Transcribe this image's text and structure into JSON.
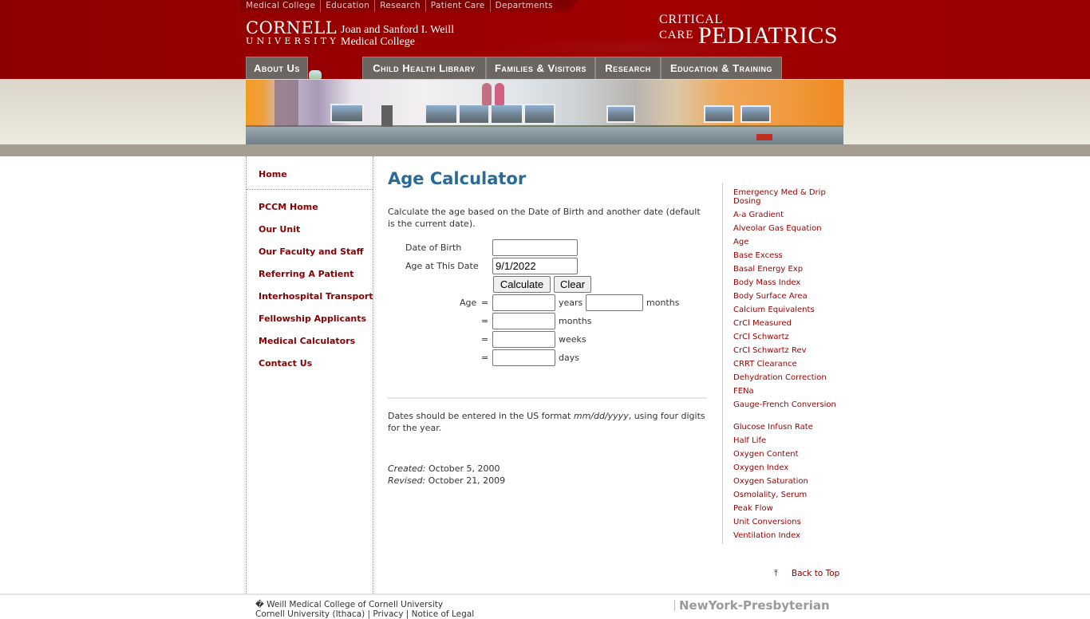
{
  "top_links": [
    "Medical College",
    "Education",
    "Research",
    "Patient Care",
    "Departments"
  ],
  "branding": {
    "cornell": "CORNELL",
    "university": "UNIVERSITY",
    "college_line1": "Joan and Sanford I. Weill",
    "college_line2": "Medical College",
    "site_critical": "CRITICAL",
    "site_care": "CARE",
    "site_pediatrics": "PEDIATRICS"
  },
  "nav_tabs": [
    "About Us",
    "Child Health Library",
    "Families & Visitors",
    "Research",
    "Education & Training"
  ],
  "sidebar": {
    "items": [
      "Home",
      "PCCM Home",
      "Our Unit",
      "Our Faculty and Staff",
      "Referring A Patient",
      "Interhospital Transport",
      "Fellowship Applicants",
      "Medical Calculators",
      "Contact Us"
    ]
  },
  "main": {
    "title": "Age Calculator",
    "intro": "Calculate the age based on the Date of Birth and another date (default is the current date).",
    "form": {
      "dob_label": "Date of Birth",
      "dob_value": "",
      "date_label": "Age at This Date",
      "date_value": "9/1/2022",
      "calculate_label": "Calculate",
      "clear_label": "Clear",
      "age_label": "Age",
      "equals": "=",
      "years_value": "",
      "years_unit": "years",
      "months_value": "",
      "months_unit": "months",
      "total_months_value": "",
      "total_months_unit": "months",
      "weeks_value": "",
      "weeks_unit": "weeks",
      "days_value": "",
      "days_unit": "days"
    },
    "note_prefix": "Dates should be entered in the US format ",
    "note_format": "mm/dd/yyyy",
    "note_suffix": ", using four digits for the year.",
    "created_label": "Created:",
    "created_date": "October 5, 2000",
    "revised_label": "Revised:",
    "revised_date": "October 21, 2009"
  },
  "calculators": [
    "Emergency Med & Drip Dosing",
    "A-a Gradient",
    "Alveolar Gas Equation",
    "Age",
    "Base Excess",
    "Basal Energy Exp",
    "Body Mass Index",
    "Body Surface Area",
    "Calcium Equivalents",
    "CrCl Measured",
    "CrCl Schwartz",
    "CrCl Schwartz Rev",
    "CRRT Clearance",
    "Dehydration Correction",
    "FENa",
    "Gauge-French Conversion",
    "Glucose Infusn Rate",
    "Half Life",
    "Oxygen Content",
    "Oxygen Index",
    "Oxygen Saturation",
    "Osmolality, Serum",
    "Peak Flow",
    "Unit Conversions",
    "Ventilation Index"
  ],
  "back_to_top": {
    "icon": "arrow-up-to-line-icon",
    "glyph": "⤒",
    "label": "Back to Top"
  },
  "footer": {
    "copyright_line": "� Weill Medical College of Cornell University",
    "line2": "Cornell University (Ithaca) | Privacy | Notice of Legal",
    "partner": "NewYork-Presbyterian"
  },
  "colors": {
    "brand_red": "#990000",
    "link_red": "#880000",
    "title_blue": "#2a6a98",
    "tab_gray": "#6b6662"
  }
}
